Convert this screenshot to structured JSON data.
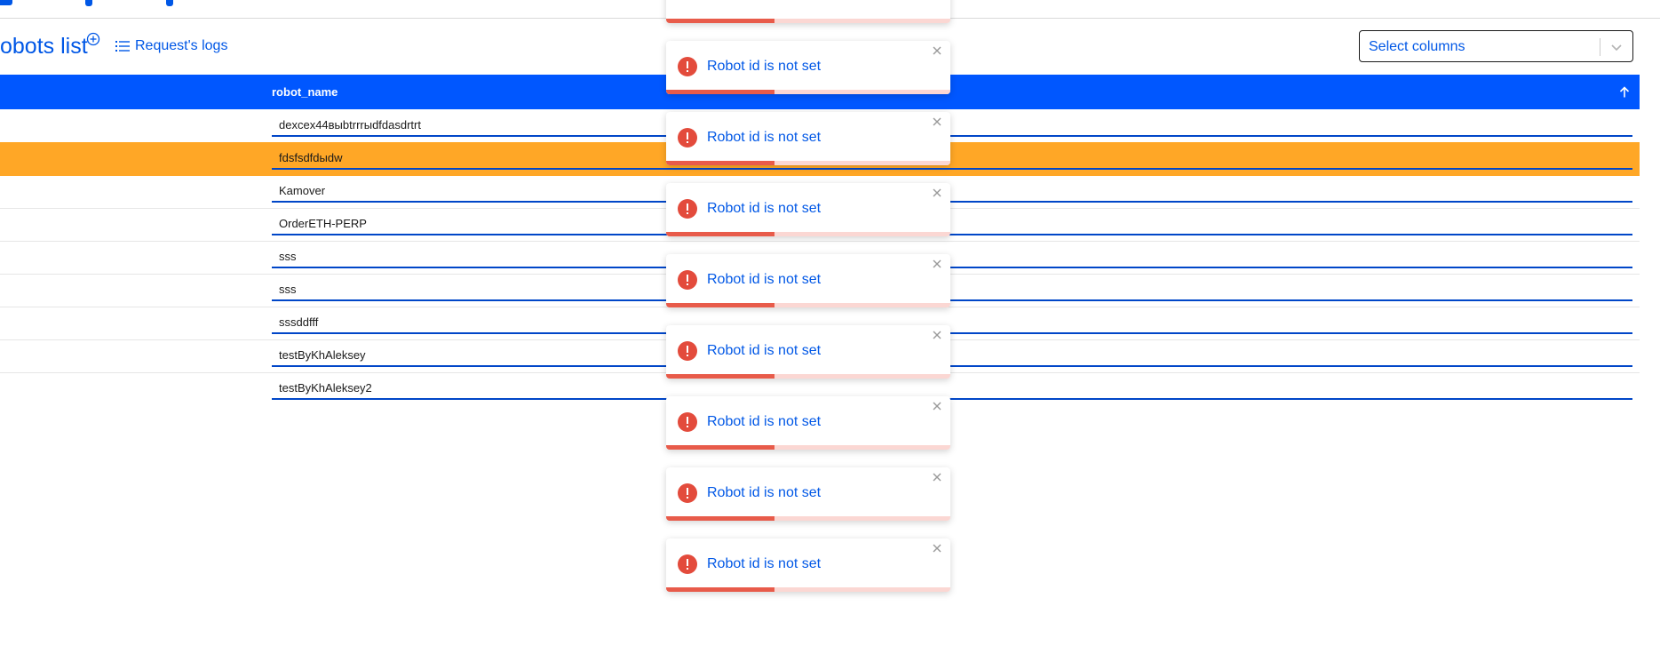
{
  "header": {
    "title": "obots list",
    "logs_link": "Request's logs"
  },
  "select": {
    "placeholder": "Select columns"
  },
  "table": {
    "column": "robot_name",
    "sort_direction": "ascending",
    "selected_row": "fdsfsdfdыdw",
    "rows": [
      "dexcex44выbtrrrыdfdasdrtrt",
      "fdsfsdfdыdw",
      "Kamover",
      "OrderETH-PERP",
      "sss",
      "sss",
      "sssddfff",
      "testByKhAleksey",
      "testByKhAleksey2"
    ]
  },
  "toasts": {
    "message": "Robot id is not set",
    "progress": 0.38,
    "items": [
      "Robot id is not set",
      "Robot id is not set",
      "Robot id is not set",
      "Robot id is not set",
      "Robot id is not set",
      "Robot id is not set",
      "Robot id is not set",
      "Robot id is not set",
      "Robot id is not set"
    ]
  },
  "colors": {
    "accent": "#0057e6",
    "header_bg": "#0057ff",
    "selected_row": "#ffa726",
    "error": "#e34b3c"
  },
  "icons": {
    "add": "plus-circle-icon",
    "logs": "list-icon",
    "chevron": "chevron-down-icon",
    "sort": "arrow-up-icon",
    "error": "exclamation-circle-icon",
    "close": "close-icon"
  }
}
